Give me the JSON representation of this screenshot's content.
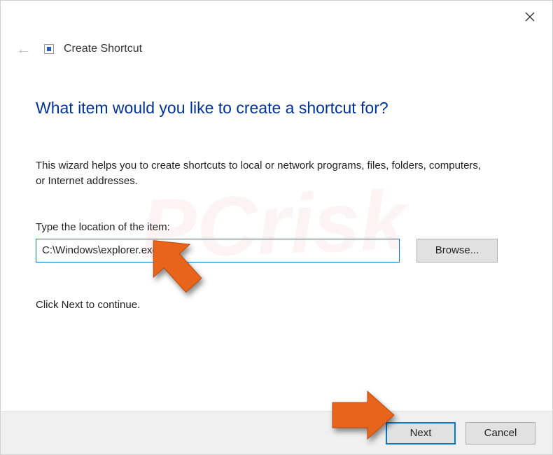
{
  "title": "Create Shortcut",
  "heading": "What item would you like to create a shortcut for?",
  "description": "This wizard helps you to create shortcuts to local or network programs, files, folders, computers, or Internet addresses.",
  "location_label": "Type the location of the item:",
  "location_value": "C:\\Windows\\explorer.exe",
  "browse_button": "Browse...",
  "continue_text": "Click Next to continue.",
  "buttons": {
    "next": "Next",
    "cancel": "Cancel"
  },
  "watermark": "PCrisk"
}
